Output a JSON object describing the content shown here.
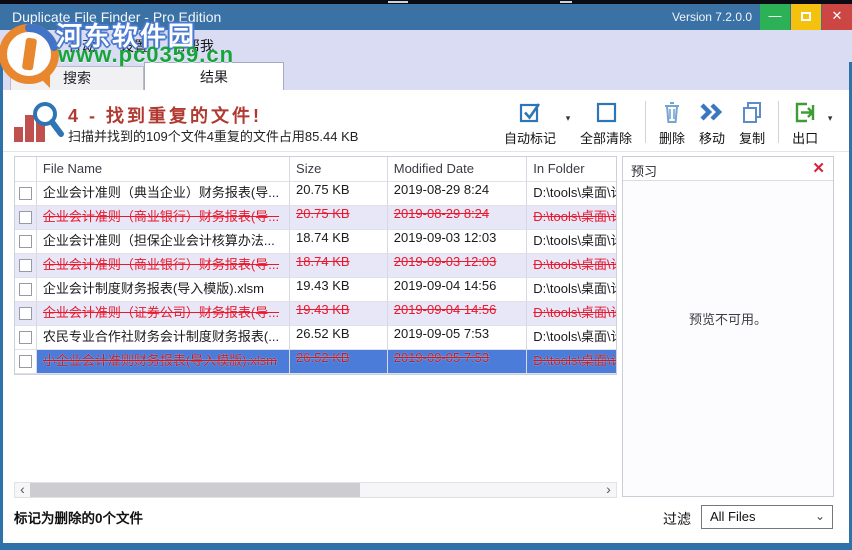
{
  "window": {
    "title": "Duplicate File Finder - Pro Edition",
    "version": "Version 7.2.0.0",
    "controls": {
      "minimize": "—",
      "maximize": "maximize-square",
      "close": "✕"
    }
  },
  "menu": {
    "items": [
      "文件",
      "行动",
      "设置",
      "帮帮我"
    ]
  },
  "tabs": [
    {
      "label": "搜索",
      "active": false
    },
    {
      "label": "结果",
      "active": true
    }
  ],
  "results_header": {
    "title": "4 - 找到重复的文件!",
    "subtitle": "扫描并找到的109个文件4重复的文件占用85.44 KB",
    "icon": "bar-chart-magnifier-icon"
  },
  "toolbar": {
    "buttons": [
      {
        "label": "自动标记",
        "icon": "checked-checkbox-icon",
        "has_dropdown": true
      },
      {
        "label": "全部清除",
        "icon": "empty-checkbox-icon",
        "has_dropdown": false
      },
      {
        "label": "删除",
        "icon": "trash-icon",
        "has_dropdown": false
      },
      {
        "label": "移动",
        "icon": "double-chevron-right-icon",
        "has_dropdown": false
      },
      {
        "label": "复制",
        "icon": "copy-icon",
        "has_dropdown": false
      },
      {
        "label": "出口",
        "icon": "export-icon",
        "has_dropdown": true
      }
    ]
  },
  "table": {
    "columns": [
      "File Name",
      "Size",
      "Modified Date",
      "In Folder"
    ],
    "rows": [
      {
        "name": "企业会计准则（典当企业）财务报表(导...",
        "size": "20.75 KB",
        "modified": "2019-08-29 8:24",
        "folder": "D:\\tools\\桌面\\计",
        "marked": false,
        "selected": false
      },
      {
        "name": "企业会计准则（商业银行）财务报表(导...",
        "size": "20.75 KB",
        "modified": "2019-08-29 8:24",
        "folder": "D:\\tools\\桌面\\计",
        "marked": true,
        "selected": false
      },
      {
        "name": "企业会计准则（担保企业会计核算办法...",
        "size": "18.74 KB",
        "modified": "2019-09-03 12:03",
        "folder": "D:\\tools\\桌面\\计",
        "marked": false,
        "selected": false
      },
      {
        "name": "企业会计准则（商业银行）财务报表(导...",
        "size": "18.74 KB",
        "modified": "2019-09-03 12:03",
        "folder": "D:\\tools\\桌面\\计",
        "marked": true,
        "selected": false
      },
      {
        "name": "企业会计制度财务报表(导入模版).xlsm",
        "size": "19.43 KB",
        "modified": "2019-09-04 14:56",
        "folder": "D:\\tools\\桌面\\计",
        "marked": false,
        "selected": false
      },
      {
        "name": "企业会计准则（证券公司）财务报表(导...",
        "size": "19.43 KB",
        "modified": "2019-09-04 14:56",
        "folder": "D:\\tools\\桌面\\计",
        "marked": true,
        "selected": false
      },
      {
        "name": "农民专业合作社财务会计制度财务报表(...",
        "size": "26.52 KB",
        "modified": "2019-09-05 7:53",
        "folder": "D:\\tools\\桌面\\计",
        "marked": false,
        "selected": false
      },
      {
        "name": "小企业会计准则财务报表(导入模版).xlsm",
        "size": "26.52 KB",
        "modified": "2019-09-05 7:53",
        "folder": "D:\\tools\\桌面\\计",
        "marked": true,
        "selected": true
      }
    ]
  },
  "preview": {
    "title": "预习",
    "close_icon": "✕",
    "message": "预览不可用。"
  },
  "statusbar": {
    "marked_text": "标记为删除的0个文件",
    "filter_label": "过滤",
    "filter_value": "All Files"
  },
  "scrollbar": {
    "left_arrow": "‹",
    "right_arrow": "›"
  },
  "watermark": {
    "site_name": "河东软件园",
    "url": "www.pc0359.cn"
  },
  "colors": {
    "titlebar_blue": "#3a72a6",
    "window_border_blue": "#2e72a9",
    "menubar_lavender": "#d9dcf2",
    "zebra_lavender": "#e7e7f7",
    "selected_row_blue": "#4b7cd9",
    "marked_red": "#e8192d",
    "header_red": "#b03931",
    "toolbar_icon_blue": "#2e75b6",
    "export_green": "#3f9b33",
    "preview_close_red": "#d81f3d",
    "minimize_green": "#2db157",
    "maximize_yellow": "#f4c10f",
    "close_red": "#cc4743",
    "watermark_blue": "#4a7ad0",
    "watermark_green": "#17a43b"
  }
}
